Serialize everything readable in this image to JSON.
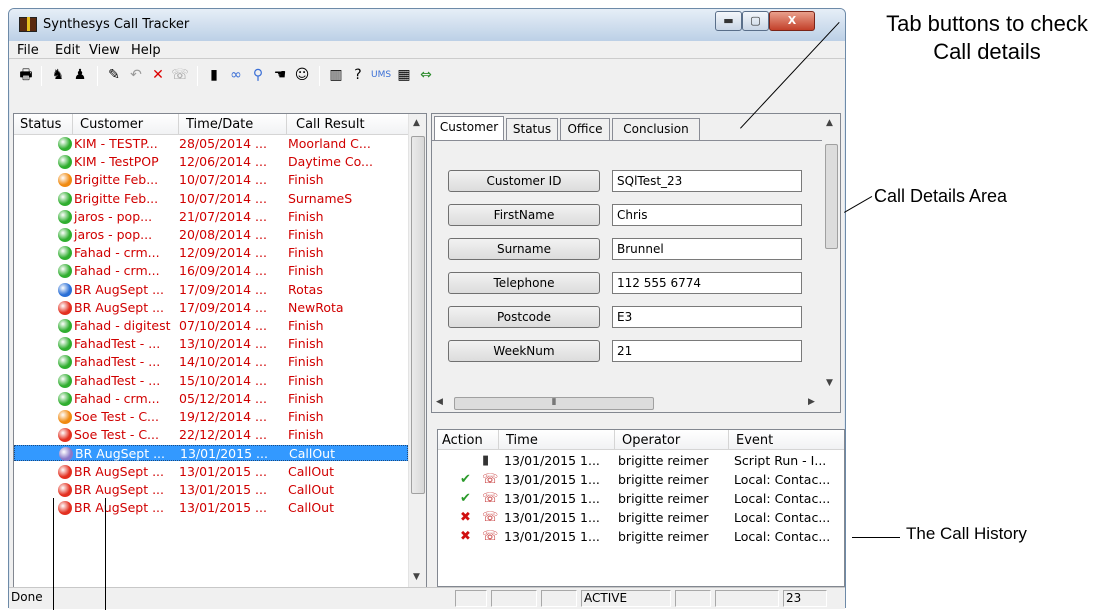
{
  "window": {
    "title": "Synthesys Call Tracker",
    "min": "▬",
    "max": "▢",
    "close": "X"
  },
  "menu": [
    "File",
    "Edit",
    "View",
    "Help"
  ],
  "list": {
    "headers": [
      "Status",
      "Customer",
      "Time/Date",
      "Call Result"
    ],
    "rows": [
      {
        "status": "green",
        "customer": "KIM - TESTP...",
        "date": "28/05/2014 ...",
        "result": "Moorland C..."
      },
      {
        "status": "green",
        "customer": "KIM - TestPOP",
        "date": "12/06/2014 ...",
        "result": "Daytime Co..."
      },
      {
        "status": "orange",
        "customer": "Brigitte Feb...",
        "date": "10/07/2014 ...",
        "result": "Finish"
      },
      {
        "status": "green",
        "customer": "Brigitte Feb...",
        "date": "10/07/2014 ...",
        "result": "SurnameS"
      },
      {
        "status": "green",
        "customer": "jaros - pop...",
        "date": "21/07/2014 ...",
        "result": "Finish"
      },
      {
        "status": "green",
        "customer": "jaros - pop...",
        "date": "20/08/2014 ...",
        "result": "Finish"
      },
      {
        "status": "green",
        "customer": "Fahad - crm...",
        "date": "12/09/2014 ...",
        "result": "Finish"
      },
      {
        "status": "green",
        "customer": "Fahad - crm...",
        "date": "16/09/2014 ...",
        "result": "Finish"
      },
      {
        "status": "blue",
        "customer": "BR AugSept ...",
        "date": "17/09/2014 ...",
        "result": "Rotas"
      },
      {
        "status": "red",
        "customer": "BR AugSept ...",
        "date": "17/09/2014 ...",
        "result": "NewRota"
      },
      {
        "status": "green",
        "customer": "Fahad - digitest",
        "date": "07/10/2014 ...",
        "result": "Finish"
      },
      {
        "status": "green",
        "customer": "FahadTest - ...",
        "date": "13/10/2014 ...",
        "result": "Finish"
      },
      {
        "status": "green",
        "customer": "FahadTest - ...",
        "date": "14/10/2014 ...",
        "result": "Finish"
      },
      {
        "status": "green",
        "customer": "FahadTest - ...",
        "date": "15/10/2014 ...",
        "result": "Finish"
      },
      {
        "status": "green",
        "customer": "Fahad - crm...",
        "date": "05/12/2014 ...",
        "result": "Finish"
      },
      {
        "status": "orange",
        "customer": "Soe Test - C...",
        "date": "19/12/2014 ...",
        "result": "Finish"
      },
      {
        "status": "red",
        "customer": "Soe Test - C...",
        "date": "22/12/2014 ...",
        "result": "Finish"
      },
      {
        "status": "purple",
        "customer": "BR AugSept ...",
        "date": "13/01/2015 ...",
        "result": "CallOut",
        "selected": true
      },
      {
        "status": "red",
        "customer": "BR AugSept ...",
        "date": "13/01/2015 ...",
        "result": "CallOut"
      },
      {
        "status": "red",
        "customer": "BR AugSept ...",
        "date": "13/01/2015 ...",
        "result": "CallOut"
      },
      {
        "status": "red",
        "customer": "BR AugSept ...",
        "date": "13/01/2015 ...",
        "result": "CallOut"
      }
    ]
  },
  "tabs": [
    "Customer",
    "Status",
    "Office",
    "Conclusion"
  ],
  "fields": [
    {
      "label": "Customer ID",
      "value": "SQlTest_23"
    },
    {
      "label": "FirstName",
      "value": "Chris"
    },
    {
      "label": "Surname",
      "value": "Brunnel"
    },
    {
      "label": "Telephone",
      "value": "112 555 6774"
    },
    {
      "label": "Postcode",
      "value": "E3"
    },
    {
      "label": "WeekNum",
      "value": "21"
    }
  ],
  "history": {
    "headers": [
      "Action",
      "Time",
      "Operator",
      "Event"
    ],
    "rows": [
      {
        "action": "",
        "time": "13/01/2015 1...",
        "operator": "brigitte reimer",
        "event": "Script Run - I..."
      },
      {
        "action": "check",
        "time": "13/01/2015 1...",
        "operator": "brigitte reimer",
        "event": "Local: Contac..."
      },
      {
        "action": "check",
        "time": "13/01/2015 1...",
        "operator": "brigitte reimer",
        "event": "Local: Contac..."
      },
      {
        "action": "cross",
        "time": "13/01/2015 1...",
        "operator": "brigitte reimer",
        "event": "Local: Contac..."
      },
      {
        "action": "cross",
        "time": "13/01/2015 1...",
        "operator": "brigitte reimer",
        "event": "Local: Contac..."
      }
    ]
  },
  "statusbar": {
    "left": "Done",
    "state": "ACTIVE",
    "count": "23"
  },
  "annotations": {
    "tabs": "Tab buttons to check Call details",
    "details": "Call Details Area",
    "history": "The Call History"
  },
  "colors": {
    "green": "#2fae2f",
    "orange": "#f08a10",
    "blue": "#2a6fd6",
    "red": "#e33020",
    "purple": "#8a78c8",
    "selected": "#3399ff"
  }
}
